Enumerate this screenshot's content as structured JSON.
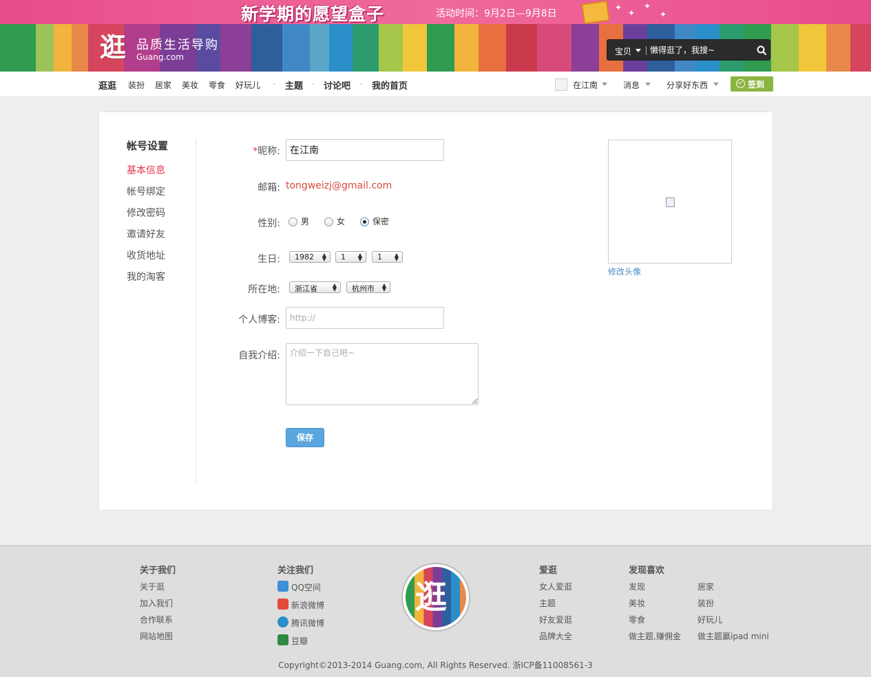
{
  "promo": {
    "title": "新学期的愿望盒子",
    "time": "活动时间：9月2日—9月8日"
  },
  "header": {
    "logo_glyph": "逛",
    "slogan": "品质生活导购",
    "domain": "Guang.com",
    "search": {
      "category": "宝贝",
      "placeholder": "懒得逛了，我搜~",
      "icon": "search-icon"
    }
  },
  "nav": {
    "items": [
      "逛逛",
      "装扮",
      "居家",
      "美妆",
      "零食",
      "好玩儿"
    ],
    "topic": "主题",
    "discuss": "讨论吧",
    "myhome": "我的首页",
    "username": "在江南",
    "messages": "消息",
    "share": "分享好东西",
    "checkin": "签到"
  },
  "sidebar": {
    "title": "帐号设置",
    "items": [
      "基本信息",
      "帐号绑定",
      "修改密码",
      "邀请好友",
      "收货地址",
      "我的淘客"
    ],
    "active_index": 0
  },
  "form": {
    "required_mark": "*",
    "nickname_label": "昵称:",
    "nickname_value": "在江南",
    "email_label": "邮箱:",
    "email_value": "tongweizj@gmail.com",
    "gender_label": "性别:",
    "gender_options": [
      "男",
      "女",
      "保密"
    ],
    "gender_selected": "保密",
    "birthday_label": "生日:",
    "birth_year": "1982",
    "birth_month": "1",
    "birth_day": "1",
    "location_label": "所在地:",
    "province": "浙江省",
    "city": "杭州市",
    "blog_label": "个人博客:",
    "blog_placeholder": "http://",
    "intro_label": "自我介绍:",
    "intro_placeholder": "介绍一下自己吧~",
    "save_label": "保存"
  },
  "avatar": {
    "change_label": "修改头像"
  },
  "footer": {
    "about": {
      "title": "关于我们",
      "links": [
        "关于逛",
        "加入我们",
        "合作联系",
        "网站地图"
      ]
    },
    "follow": {
      "title": "关注我们",
      "links": [
        {
          "label": "QQ空间",
          "icon": "qzone-icon"
        },
        {
          "label": "新浪微博",
          "icon": "weibo-icon"
        },
        {
          "label": "腾讯微博",
          "icon": "tencent-weibo-icon"
        },
        {
          "label": "豆瓣",
          "icon": "douban-icon"
        }
      ]
    },
    "logo_glyph": "逛",
    "aiguang": {
      "title": "爱逛",
      "links": [
        "女人爱逛",
        "主题",
        "好友爱逛",
        "品牌大全"
      ]
    },
    "discover": {
      "title": "发现喜欢",
      "col1": [
        "发现",
        "美妆",
        "零食",
        "做主题,赚佣金"
      ],
      "col2": [
        "居家",
        "装扮",
        "好玩儿",
        "做主题赢ipad mini"
      ]
    },
    "copyright": "Copyright©2013-2014 Guang.com, All Rights Reserved. 浙ICP备11008561-3"
  },
  "colors": {
    "accent_red": "#e3344f",
    "link_blue": "#4a8bc6",
    "save_blue": "#5ba7dd",
    "checkin_green": "#8cb53f"
  }
}
